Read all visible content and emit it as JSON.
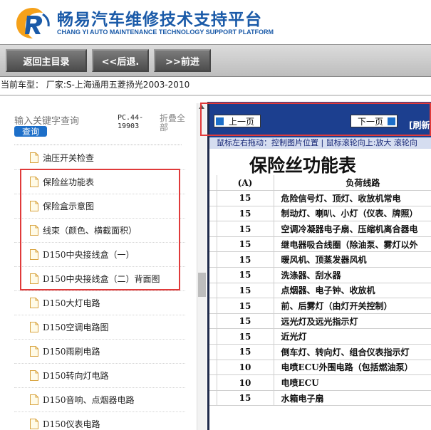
{
  "header": {
    "title": "畅易汽车维修技术支持平台",
    "subtitle": "CHANG YI AUTO MAINTENANCE TECHNOLOGY SUPPORT PLATFORM"
  },
  "nav": {
    "back_to_main": "返回主目录",
    "back": "<<后退.",
    "forward": ">>前进"
  },
  "current_model": "当前车型： 厂家:S-上海通用五菱扬光2003-2010",
  "sidebar": {
    "search_placeholder": "输入关键字查询",
    "search_button": "查询",
    "pc_code": "PC.44-19903",
    "collapse_all": "折叠全部",
    "items": [
      {
        "label": "油压开关检查"
      },
      {
        "label": "保险丝功能表"
      },
      {
        "label": "保险盒示意图"
      },
      {
        "label": "线束（颜色、横截面积）"
      },
      {
        "label": "D150中央接线盒（一）"
      },
      {
        "label": "D150中央接线盒（二）背面图"
      },
      {
        "label": "D150大灯电路"
      },
      {
        "label": "D150空调电路图"
      },
      {
        "label": "D150雨刷电路"
      },
      {
        "label": "D150转向灯电路"
      },
      {
        "label": "D150音响、点烟器电路"
      },
      {
        "label": "D150仪表电路"
      }
    ]
  },
  "doc": {
    "prev_page": "上一页",
    "next_page": "下一页",
    "refresh": "[刷新",
    "hint": "鼠标左右拖动：控制图片位置 | 鼠标滚轮向上:放大  滚轮向",
    "title": "保险丝功能表",
    "table": {
      "headers": [
        "(A)",
        "负荷线路"
      ],
      "rows": [
        {
          "amp": "15",
          "load": "危险信号灯、顶灯、收放机常电"
        },
        {
          "amp": "15",
          "load": "制动灯、喇叭、小灯（仪表、牌照）"
        },
        {
          "amp": "15",
          "load": "空调冷凝器电子扇、压缩机离合器电"
        },
        {
          "amp": "15",
          "load": "继电器吸合线圈（除油泵、雾灯以外"
        },
        {
          "amp": "15",
          "load": "暖风机、顶蒸发器风机"
        },
        {
          "amp": "15",
          "load": "洗涤器、刮水器"
        },
        {
          "amp": "15",
          "load": "点烟器、电子钟、收放机"
        },
        {
          "amp": "15",
          "load": "前、后雾灯（由灯开关控制）"
        },
        {
          "amp": "15",
          "load": "远光灯及远光指示灯"
        },
        {
          "amp": "15",
          "load": "近光灯"
        },
        {
          "amp": "15",
          "load": "倒车灯、转向灯、组合仪表指示灯"
        },
        {
          "amp": "10",
          "load": "电喷ECU外围电路（包括燃油泵）"
        },
        {
          "amp": "10",
          "load": "电喷ECU"
        },
        {
          "amp": "15",
          "load": "水箱电子扇"
        }
      ]
    }
  },
  "colors": {
    "brand_blue": "#1a5aa8",
    "toolbar_navy": "#1c3f8f",
    "highlight_red": "#e03a3a",
    "logo_orange": "#f5a11a"
  }
}
